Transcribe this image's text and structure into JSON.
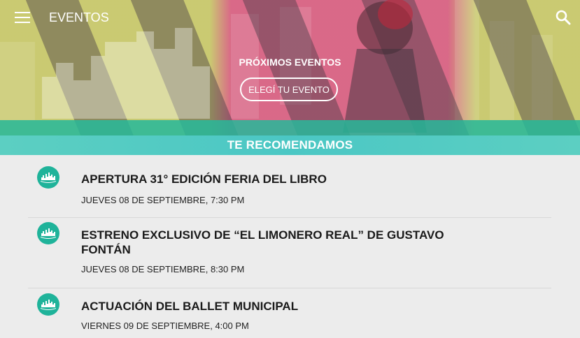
{
  "app": {
    "title": "EVENTOS"
  },
  "hero": {
    "label": "PRÓXIMOS EVENTOS",
    "button_label": "ELEGÍ TU EVENTO"
  },
  "section": {
    "title": "TE RECOMENDAMOS"
  },
  "events": [
    {
      "title": "APERTURA 31° EDICIÓN FERIA DEL LIBRO",
      "date": "JUEVES 08 DE SEPTIEMBRE, 7:30 PM"
    },
    {
      "title": "ESTRENO EXCLUSIVO DE “EL LIMONERO REAL” DE GUSTAVO FONTÁN",
      "date": "JUEVES 08 DE SEPTIEMBRE, 8:30 PM"
    },
    {
      "title": "ACTUACIÓN DEL BALLET MUNICIPAL",
      "date": "VIERNES 09 DE SEPTIEMBRE, 4:00 PM"
    }
  ],
  "colors": {
    "accent": "#1fb39a",
    "band": "#4bc7c4",
    "background": "#ececec"
  },
  "icons": {
    "menu": "menu-icon",
    "search": "search-icon",
    "event": "city-skyline-icon"
  }
}
